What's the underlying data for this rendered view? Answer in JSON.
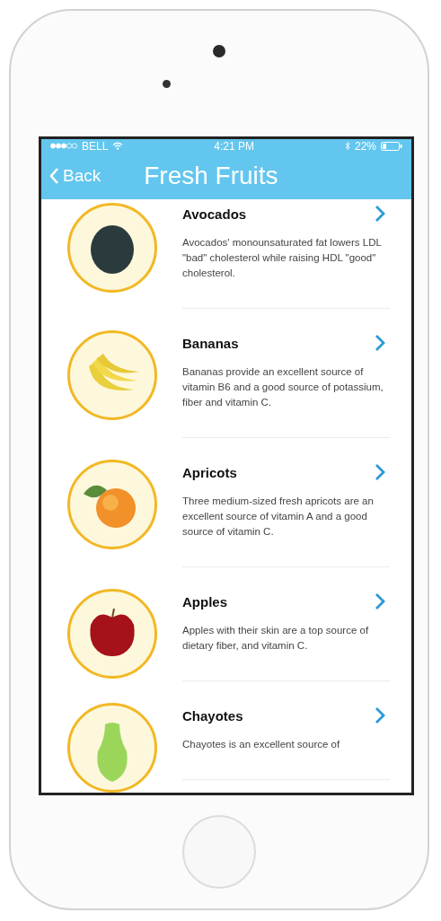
{
  "status_bar": {
    "carrier": "BELL",
    "time": "4:21 PM",
    "battery": "22%"
  },
  "nav_bar": {
    "back": "Back",
    "title": "Fresh Fruits"
  },
  "items": [
    {
      "kind": "avocado",
      "title": "Avocados",
      "description": "Avocados' monounsaturated fat lowers LDL \"bad\" cholesterol while raising HDL \"good\" cholesterol."
    },
    {
      "kind": "banana",
      "title": "Bananas",
      "description": "Bananas provide an excellent source of vitamin B6 and a good source of potassium, fiber and vitamin C."
    },
    {
      "kind": "apricot",
      "title": "Apricots",
      "description": "Three medium-sized fresh apricots are an excellent source of vitamin A and a good source of vitamin C."
    },
    {
      "kind": "apple",
      "title": "Apples",
      "description": "Apples with their skin are a top source of dietary fiber, and vitamin C."
    },
    {
      "kind": "chayote",
      "title": "Chayotes",
      "description": "Chayotes is an excellent source of"
    }
  ]
}
